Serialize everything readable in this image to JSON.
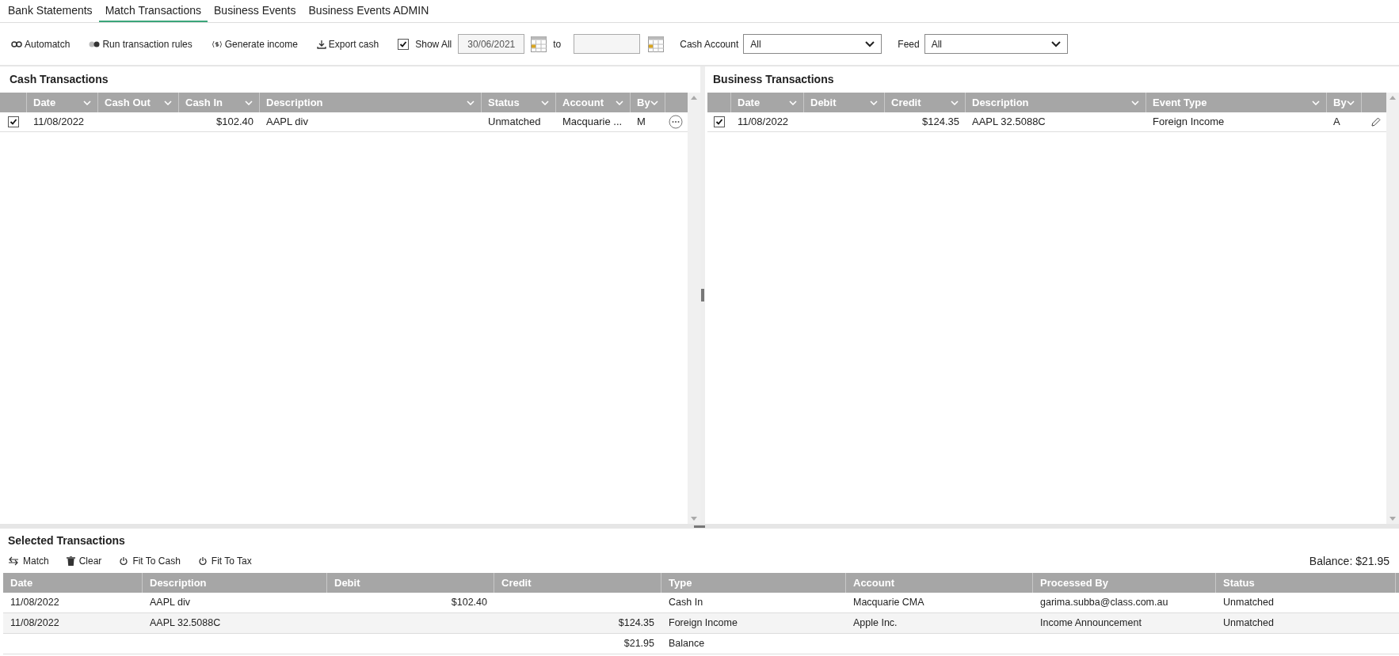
{
  "tabs": [
    {
      "label": "Bank Statements",
      "selected": false
    },
    {
      "label": "Match Transactions",
      "selected": true
    },
    {
      "label": "Business Events",
      "selected": false
    },
    {
      "label": "Business Events ADMIN",
      "selected": false
    }
  ],
  "toolbar": {
    "buttons": [
      "Automatch",
      "Run transaction rules",
      "Generate income",
      "Export cash"
    ],
    "show_all": {
      "label": "Show All",
      "checked": true
    },
    "date_from": "30/06/2021",
    "to_label": "to",
    "cash_account": {
      "label": "Cash Account",
      "value": "All"
    },
    "feed": {
      "label": "Feed",
      "value": "All"
    }
  },
  "cash_transactions": {
    "title": "Cash Transactions",
    "columns": [
      "Date",
      "Cash Out",
      "Cash In",
      "Description",
      "Status",
      "Account",
      "By"
    ],
    "rows": [
      {
        "checked": true,
        "cells": [
          "11/08/2022",
          null,
          "$102.40",
          "AAPL div",
          "Unmatched",
          "Macquarie ...",
          "M"
        ]
      }
    ]
  },
  "business_transactions": {
    "title": "Business Transactions",
    "columns": [
      "Date",
      "Debit",
      "Credit",
      "Description",
      "Event Type",
      "By"
    ],
    "rows": [
      {
        "checked": true,
        "cells": [
          "11/08/2022",
          null,
          "$124.35",
          "AAPL 32.5088C",
          "Foreign Income",
          "A"
        ]
      }
    ]
  },
  "selected_transactions": {
    "title": "Selected Transactions",
    "buttons": [
      "Match",
      "Clear",
      "Fit To Cash",
      "Fit To Tax"
    ],
    "balance": "Balance: $21.95",
    "columns": [
      "Date",
      "Description",
      "Debit",
      "Credit",
      "Type",
      "Account",
      "Processed By",
      "Status"
    ],
    "rows": [
      {
        "cells": [
          "11/08/2022",
          "AAPL div",
          "$102.40",
          null,
          "Cash In",
          "Macquarie CMA",
          "garima.subba@class.com.au",
          "Unmatched"
        ]
      },
      {
        "cells": [
          "11/08/2022",
          "AAPL 32.5088C",
          null,
          "$124.35",
          "Foreign Income",
          "Apple Inc.",
          "Income Announcement",
          "Unmatched"
        ]
      },
      {
        "cells": [
          null,
          null,
          null,
          "$21.95",
          "Balance",
          null,
          null,
          null
        ]
      }
    ]
  }
}
